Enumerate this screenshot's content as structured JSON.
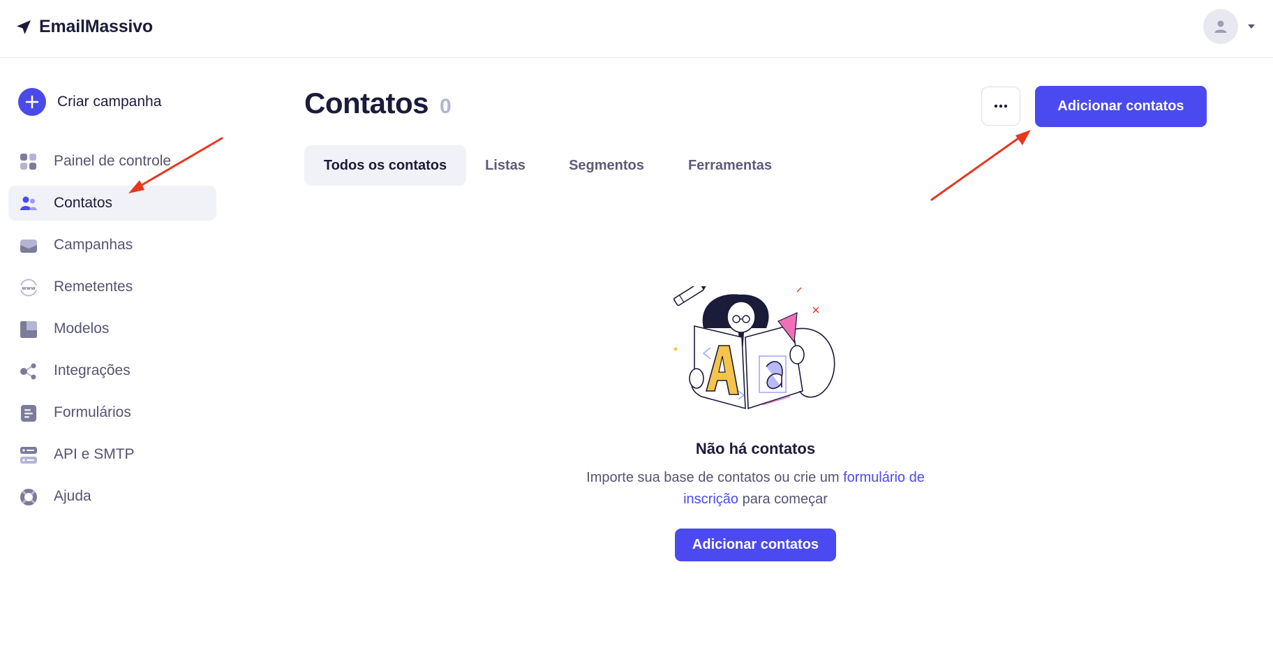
{
  "app": {
    "name": "EmailMassivo"
  },
  "sidebar": {
    "create_label": "Criar campanha",
    "items": [
      {
        "label": "Painel de controle",
        "icon": "dashboard-icon",
        "active": false
      },
      {
        "label": "Contatos",
        "icon": "contacts-icon",
        "active": true
      },
      {
        "label": "Campanhas",
        "icon": "campaigns-icon",
        "active": false
      },
      {
        "label": "Remetentes",
        "icon": "www-icon",
        "active": false
      },
      {
        "label": "Modelos",
        "icon": "templates-icon",
        "active": false
      },
      {
        "label": "Integrações",
        "icon": "integrations-icon",
        "active": false
      },
      {
        "label": "Formulários",
        "icon": "forms-icon",
        "active": false
      },
      {
        "label": "API e SMTP",
        "icon": "server-icon",
        "active": false
      },
      {
        "label": "Ajuda",
        "icon": "lifebuoy-icon",
        "active": false
      }
    ]
  },
  "main": {
    "title": "Contatos",
    "count": "0",
    "more_label": "···",
    "add_button_label": "Adicionar contatos",
    "tabs": [
      {
        "label": "Todos os contatos",
        "active": true
      },
      {
        "label": "Listas",
        "active": false
      },
      {
        "label": "Segmentos",
        "active": false
      },
      {
        "label": "Ferramentas",
        "active": false
      }
    ],
    "empty": {
      "title": "Não há contatos",
      "text_before": "Importe sua base de contatos ou crie um ",
      "link_text": "formulário de inscrição",
      "text_after": " para começar",
      "button_label": "Adicionar contatos"
    }
  },
  "colors": {
    "accent": "#4a4af0",
    "text_dark": "#1b1b3a",
    "text_muted": "#545472",
    "active_bg": "#f1f2f7",
    "annotation_arrow": "#e8361f"
  }
}
